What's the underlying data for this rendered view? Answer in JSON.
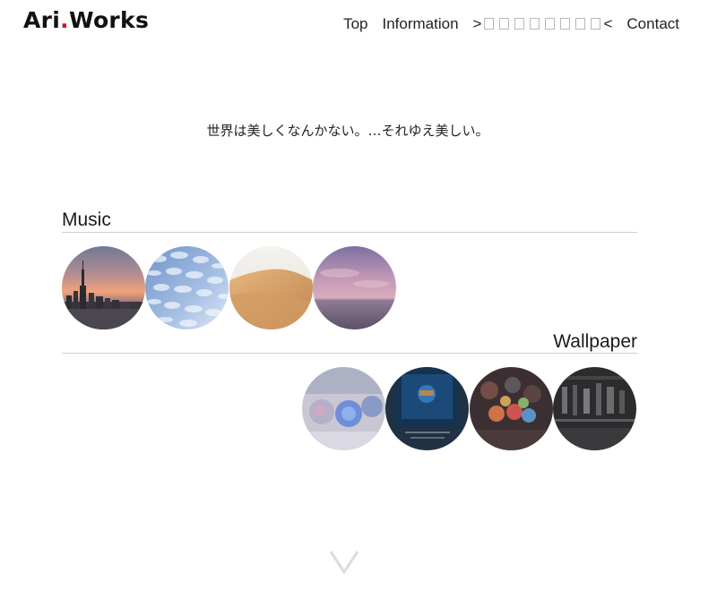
{
  "header": {
    "logo_prefix": "Ari",
    "logo_dot": ".",
    "logo_suffix": "Works",
    "nav": {
      "top": "Top",
      "information": "Information",
      "garbled_open": ">",
      "garbled_close": "<",
      "contact": "Contact"
    }
  },
  "tagline": "世界は美しくなんかない。…それゆえ美しい。",
  "sections": {
    "music": {
      "title": "Music",
      "thumbnails": [
        "city-sunset",
        "cloud-sky",
        "desert-dune",
        "purple-sea"
      ]
    },
    "wallpaper": {
      "title": "Wallpaper",
      "thumbnails": [
        "blue-flowers",
        "underwater-night",
        "bokeh-lights",
        "dark-interior"
      ]
    }
  },
  "colors": {
    "logo_dot": "#c8161d",
    "rule": "#cfcfcf",
    "chevron": "#dcdcdc"
  },
  "icons": {
    "scroll": "chevron-down-icon"
  }
}
